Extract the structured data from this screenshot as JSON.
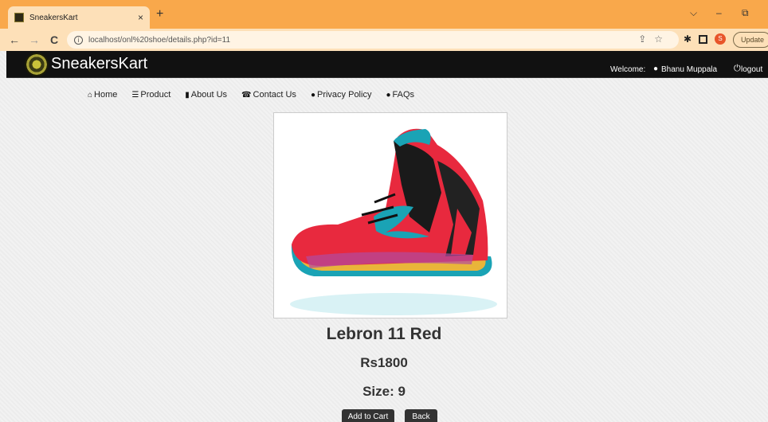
{
  "browser": {
    "tab_title": "SneakersKart",
    "tab_close": "×",
    "new_tab": "+",
    "url": "localhost/onl%20shoe/details.php?id=11",
    "profile_initial": "S",
    "update_label": "Update",
    "nav_back": "←",
    "nav_forward": "→",
    "nav_reload": "C"
  },
  "site": {
    "brand": "SneakersKart",
    "welcome_label": "Welcome:",
    "username": "Bhanu Muppala",
    "logout_label": "logout"
  },
  "nav": [
    {
      "label": "Home",
      "icon": "home-icon"
    },
    {
      "label": "Product",
      "icon": "list-icon"
    },
    {
      "label": "About Us",
      "icon": "bookmark-icon"
    },
    {
      "label": "Contact Us",
      "icon": "contact-icon"
    },
    {
      "label": "Privacy Policy",
      "icon": "info-icon"
    },
    {
      "label": "FAQs",
      "icon": "question-icon"
    }
  ],
  "product": {
    "name": "Lebron 11 Red",
    "price": "Rs1800",
    "size": "Size: 9",
    "image": "red-sneaker-image"
  },
  "buttons": {
    "add_to_cart": "Add to Cart",
    "back": "Back"
  },
  "colors": {
    "tabstrip": "#f9a84b",
    "header": "#111111",
    "button": "#333333"
  }
}
